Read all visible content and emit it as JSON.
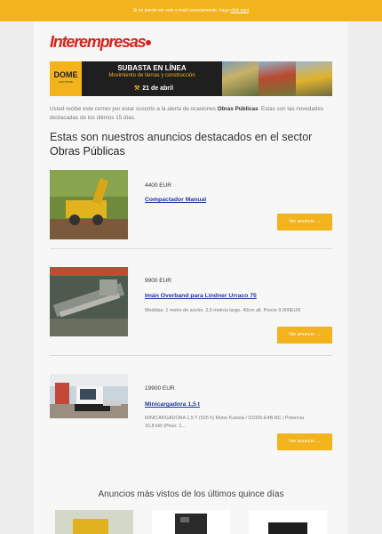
{
  "topbar": {
    "text": "Si no puede ver este e-mail correctamente, haga ",
    "link": "click aquí"
  },
  "logo": {
    "text": "Interempresas"
  },
  "banner": {
    "brand": "DOME",
    "brand_sub": "AUCTIONS",
    "title": "SUBASTA EN LÍNEA",
    "subtitle": "Movimiento de tierras y construcción",
    "date": "21 de abril"
  },
  "intro": {
    "before": "Usted recibe este correo por estar suscrito a la alerta de ocasiones ",
    "sector": "Obras Públicas",
    "after": ". Estas son las novedades destacadas de los últimos 15 días."
  },
  "heading": {
    "before": "Estas son nuestros anuncios destacados en el sector ",
    "sector": "Obras Públicas"
  },
  "listings": [
    {
      "price": "4400 EUR",
      "title": "Compactador Manual",
      "desc": "",
      "button": "Ver anuncio →"
    },
    {
      "price": "9900 EUR",
      "title": "Imán Overband para Lindner Urraco 75",
      "desc": "Medidas: 1 metro de ancho, 2,5 metros largo, 40cm alt. Precio 9.900EUR",
      "button": "Ver anuncio →"
    },
    {
      "price": "19900 EUR",
      "title": "Minicargadora 1,5 t",
      "desc": "MINICARGADORA 1,5 T (925 h) Motor Kubota / D1005-E4B-BC / Potencia 16,8 kW (Peso: 1...",
      "button": "Ver anuncio →"
    }
  ],
  "section2": {
    "title": "Anuncios más vistos de los últimos quince días"
  },
  "colors": {
    "accent": "#f2b31c",
    "brand": "#d8231c",
    "link": "#1a3a9c"
  }
}
